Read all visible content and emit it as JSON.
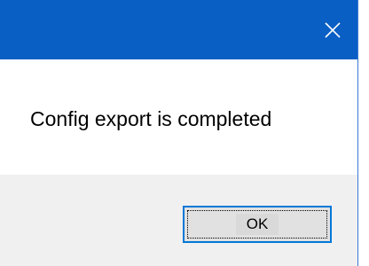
{
  "dialog": {
    "message": "Config export is completed",
    "ok_label": "OK",
    "close_icon": "close-icon"
  },
  "colors": {
    "titlebar": "#0a5fc4",
    "footer": "#f0f0f0",
    "button_border": "#0078d7"
  }
}
